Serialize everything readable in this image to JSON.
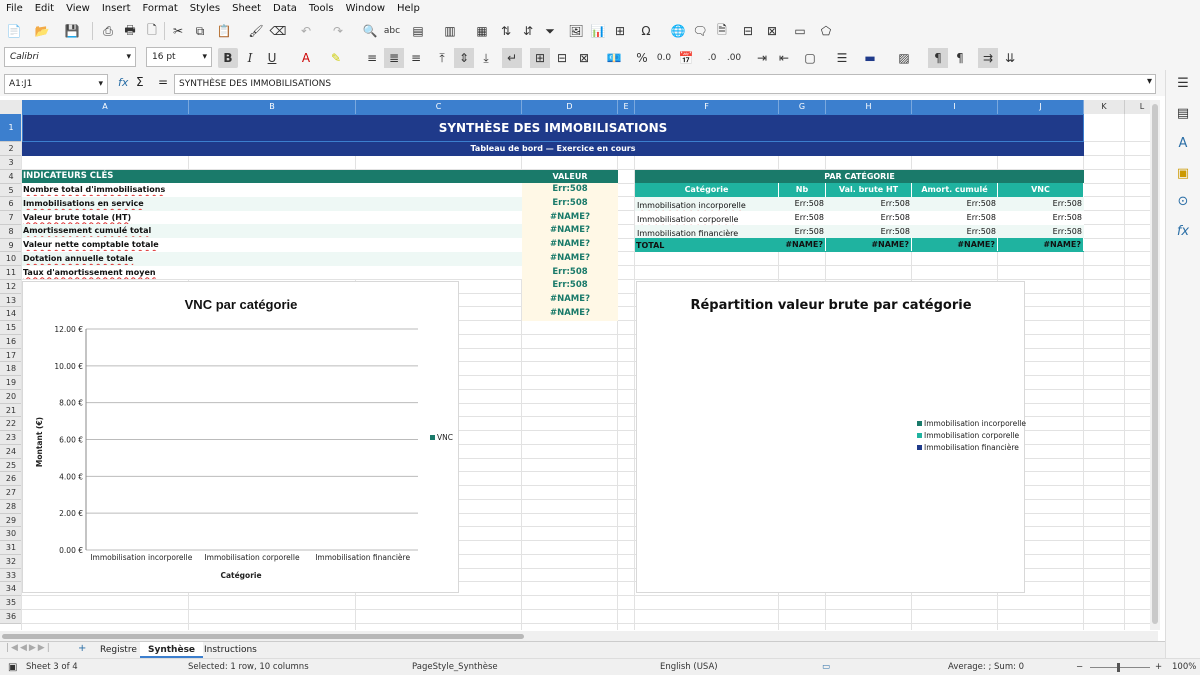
{
  "menu": [
    "File",
    "Edit",
    "View",
    "Insert",
    "Format",
    "Styles",
    "Sheet",
    "Data",
    "Tools",
    "Window",
    "Help"
  ],
  "toolbar": {
    "font_name": "Calibri",
    "font_size": "16 pt",
    "bold": "B",
    "italic": "I",
    "underline": "U",
    "percent": "%",
    "decimal": "0.0"
  },
  "formula": {
    "name_box": "A1:J1",
    "content": "SYNTHÈSE DES IMMOBILISATIONS"
  },
  "columns": [
    "A",
    "B",
    "C",
    "D",
    "E",
    "F",
    "G",
    "H",
    "I",
    "J",
    "K",
    "L"
  ],
  "rows": [
    "1",
    "2",
    "3",
    "4",
    "5",
    "6",
    "7",
    "8",
    "9",
    "10",
    "11",
    "12",
    "13",
    "14",
    "15",
    "16",
    "17",
    "18",
    "19",
    "20",
    "21",
    "22",
    "23",
    "24",
    "25",
    "26",
    "27",
    "28",
    "29",
    "30",
    "31",
    "32",
    "33",
    "34",
    "35",
    "36"
  ],
  "sheet": {
    "title": "SYNTHÈSE DES IMMOBILISATIONS",
    "subtitle": "Tableau de bord — Exercice en cours",
    "kpi_header": "INDICATEURS CLÉS",
    "kpi_value_header": "VALEUR",
    "kpis": [
      {
        "label": "Nombre total d'immobilisations",
        "value": "Err:508"
      },
      {
        "label": "Immobilisations en service",
        "value": "Err:508"
      },
      {
        "label": "Valeur brute totale (HT)",
        "value": "#NAME?"
      },
      {
        "label": "Amortissement cumulé total",
        "value": "#NAME?"
      },
      {
        "label": "Valeur nette comptable totale",
        "value": "#NAME?"
      },
      {
        "label": "Dotation annuelle totale",
        "value": "#NAME?"
      },
      {
        "label": "Taux d'amortissement moyen",
        "value": "Err:508"
      },
      {
        "label": "",
        "value": "Err:508"
      },
      {
        "label": "",
        "value": "#NAME?"
      },
      {
        "label": "",
        "value": "#NAME?"
      }
    ],
    "cat_header": "PAR CATÉGORIE",
    "cat_columns": [
      "Catégorie",
      "Nb",
      "Val. brute HT",
      "Amort. cumulé",
      "VNC"
    ],
    "categories": [
      {
        "name": "Immobilisation incorporelle",
        "nb": "Err:508",
        "brute": "Err:508",
        "amort": "Err:508",
        "vnc": "Err:508"
      },
      {
        "name": "Immobilisation corporelle",
        "nb": "Err:508",
        "brute": "Err:508",
        "amort": "Err:508",
        "vnc": "Err:508"
      },
      {
        "name": "Immobilisation financière",
        "nb": "Err:508",
        "brute": "Err:508",
        "amort": "Err:508",
        "vnc": "Err:508"
      }
    ],
    "total": {
      "label": "TOTAL",
      "nb": "#NAME?",
      "brute": "#NAME?",
      "amort": "#NAME?",
      "vnc": "#NAME?"
    }
  },
  "chart_data": [
    {
      "type": "bar",
      "title": "VNC par catégorie",
      "categories": [
        "Immobilisation incorporelle",
        "Immobilisation corporelle",
        "Immobilisation financière"
      ],
      "series": [
        {
          "name": "VNC",
          "values": [
            0,
            0,
            0
          ]
        }
      ],
      "xlabel": "Catégorie",
      "ylabel": "Montant (€)",
      "ylim": [
        0,
        12
      ],
      "yticks": [
        "0.00 €",
        "2.00 €",
        "4.00 €",
        "6.00 €",
        "8.00 €",
        "10.00 €",
        "12.00 €"
      ],
      "grid": true,
      "legend": "right",
      "color": "#1a7a6a"
    },
    {
      "type": "pie",
      "title": "Répartition valeur brute par catégorie",
      "categories": [
        "Immobilisation incorporelle",
        "Immobilisation corporelle",
        "Immobilisation financière"
      ],
      "values": [
        0,
        0,
        0
      ],
      "legend": "right",
      "colors": [
        "#1a7a6a",
        "#1fb3a0",
        "#1f3a8a"
      ]
    }
  ],
  "tabs": [
    "Registre",
    "Synthèse",
    "Instructions"
  ],
  "status": {
    "sheet": "Sheet 3 of 4",
    "selection": "Selected: 1 row, 10 columns",
    "page_style": "PageStyle_Synthèse",
    "language": "English (USA)",
    "summary": "Average: ; Sum: 0",
    "zoom": "100%"
  },
  "colors": {
    "navy": "#1f3a8a",
    "teal": "#1a7a6a",
    "teal_light": "#1fb3a0",
    "highlight": "#3c7fce"
  }
}
